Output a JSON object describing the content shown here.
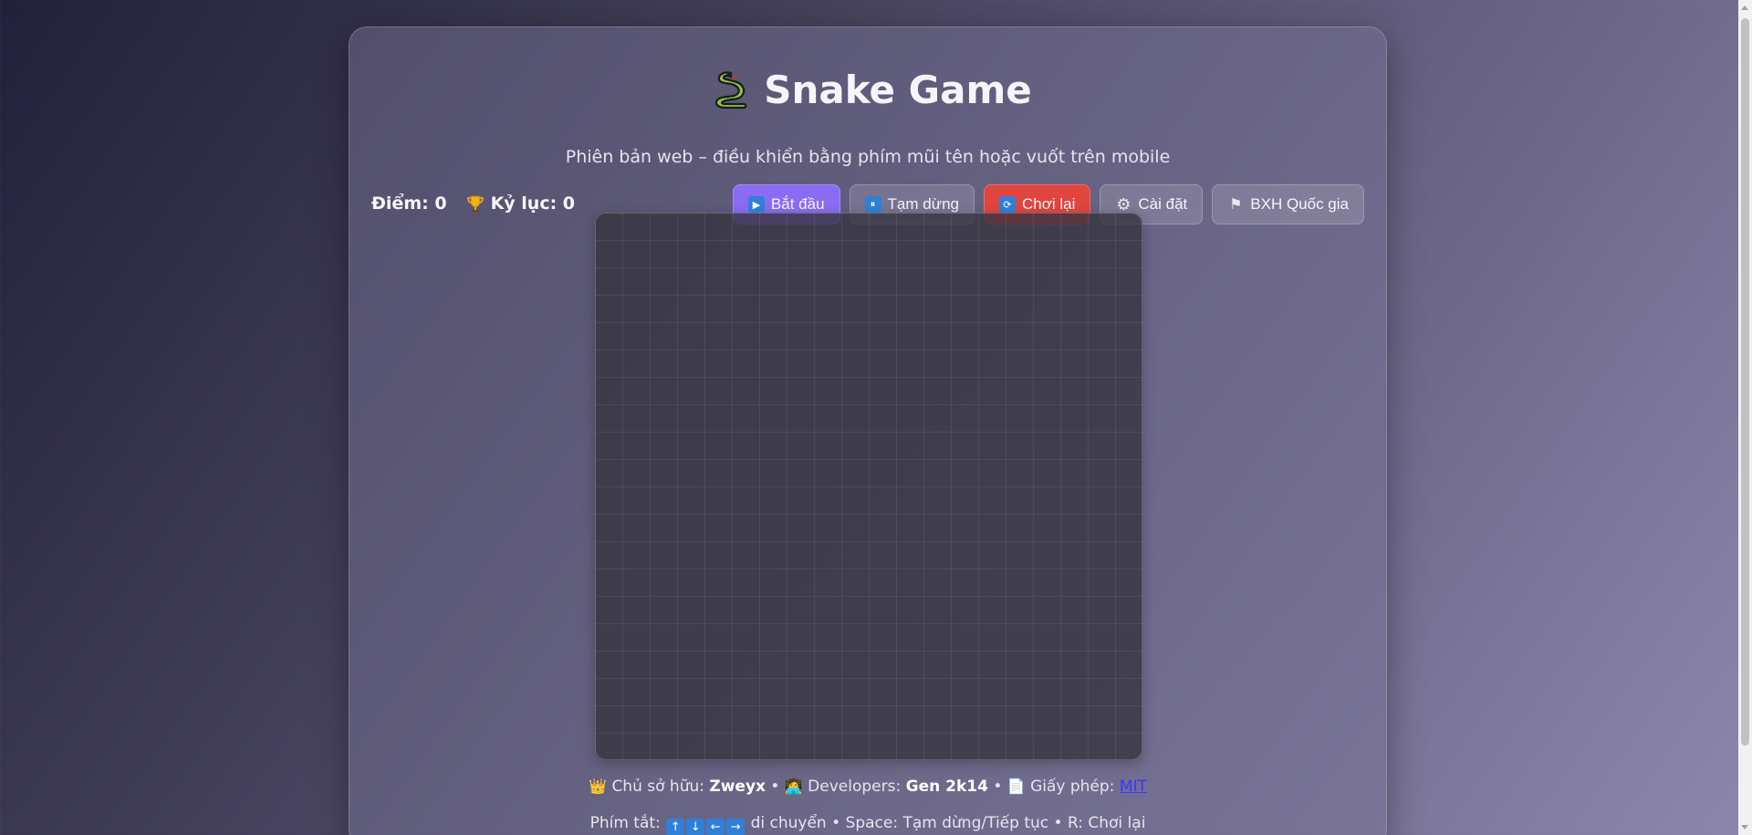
{
  "header": {
    "title": "Snake Game",
    "subtitle": "Phiên bản web – điều khiển bằng phím mũi tên hoặc vuốt trên mobile",
    "title_icon": "snake-icon"
  },
  "scores": {
    "score_label": "Điểm: 0",
    "record_label": "Kỷ lục: 0",
    "record_icon": "trophy-icon"
  },
  "toolbar": {
    "start_label": "Bắt đầu",
    "pause_label": "Tạm dừng",
    "restart_label": "Chơi lại",
    "settings_label": "Cài đặt",
    "leaderboard_label": "BXH Quốc gia"
  },
  "colors": {
    "start_button": "#8a6cf2",
    "restart_button": "#e0453f",
    "link": "#3d34ff"
  },
  "footer": {
    "owner_label": "Chủ sở hữu:",
    "owner_name": "Zweyx",
    "separator": "•",
    "developers_label": "Developers:",
    "developers_name": "Gen 2k14",
    "license_label": "Giấy phép:",
    "license_link": "MIT",
    "shortcuts_label": "Phím tắt:",
    "keys": [
      "↑",
      "↓",
      "←",
      "→"
    ],
    "shortcuts_text": "di chuyển • Space: Tạm dừng/Tiếp tục • R: Chơi lại"
  }
}
